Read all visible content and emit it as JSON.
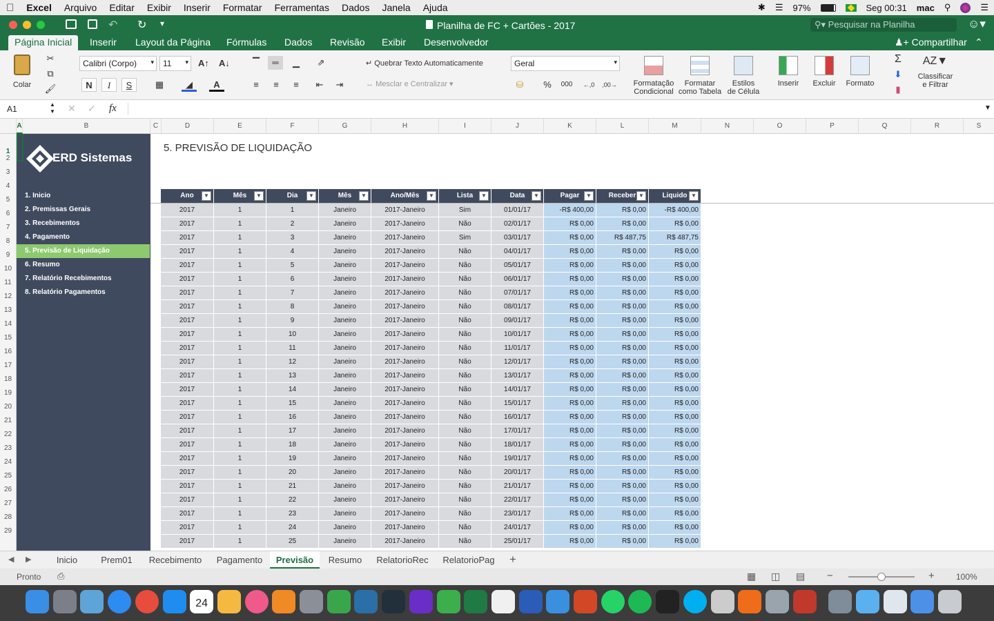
{
  "menubar": {
    "app": "Excel",
    "items": [
      "Arquivo",
      "Editar",
      "Exibir",
      "Inserir",
      "Formatar",
      "Ferramentas",
      "Dados",
      "Janela",
      "Ajuda"
    ],
    "battery": "97%",
    "time": "Seg 00:31",
    "user": "mac"
  },
  "window": {
    "title": "Planilha de FC + Cartões - 2017",
    "search_placeholder": "Pesquisar na Planilha"
  },
  "ribbon": {
    "tabs": [
      "Página Inicial",
      "Inserir",
      "Layout da Página",
      "Fórmulas",
      "Dados",
      "Revisão",
      "Exibir",
      "Desenvolvedor"
    ],
    "share": "Compartilhar",
    "paste": "Colar",
    "font": "Calibri (Corpo)",
    "font_size": "11",
    "wrap": "Quebrar Texto Automaticamente",
    "merge": "Mesclar e Centralizar",
    "number_format": "Geral",
    "percent": "%",
    "thousands": "000",
    "cond_format": [
      "Formatação",
      "Condicional"
    ],
    "format_table": [
      "Formatar",
      "como Tabela"
    ],
    "cell_styles": [
      "Estilos",
      "de Célula"
    ],
    "insert": "Inserir",
    "delete": "Excluir",
    "format": "Formato",
    "sort_filter": [
      "Classificar",
      "e Filtrar"
    ],
    "bold": "N",
    "italic": "I",
    "underline": "S"
  },
  "formula": {
    "name_box": "A1",
    "fx": "fx",
    "value": ""
  },
  "columns": [
    "A",
    "B",
    "C",
    "D",
    "E",
    "F",
    "G",
    "H",
    "I",
    "J",
    "K",
    "L",
    "M",
    "N",
    "O",
    "P",
    "Q",
    "R",
    "S"
  ],
  "rows": [
    "1",
    "2",
    "3",
    "4",
    "5",
    "6",
    "7",
    "8",
    "9",
    "10",
    "11",
    "12",
    "13",
    "14",
    "15",
    "16",
    "17",
    "18",
    "19",
    "20",
    "21",
    "22",
    "23",
    "24",
    "25",
    "26",
    "27",
    "28",
    "29"
  ],
  "sidebar": {
    "logo": "ERD Sistemas",
    "items": [
      "1. Inicio",
      "2. Premissas Gerais",
      "3. Recebimentos",
      "4. Pagamento",
      "5. Previsão de Liquidação",
      "6. Resumo",
      "7. Relatório Recebimentos",
      "8. Relatório Pagamentos"
    ],
    "active_index": 4
  },
  "sheet": {
    "title": "5. PREVISÃO DE LIQUIDAÇÃO",
    "headers": [
      "Ano",
      "Mês",
      "Dia",
      "Mês",
      "Ano/Mês",
      "Lista",
      "Data",
      "Pagar",
      "Receber",
      "Liquido"
    ],
    "rows": [
      [
        "2017",
        "1",
        "1",
        "Janeiro",
        "2017-Janeiro",
        "Sim",
        "01/01/17",
        "-R$ 400,00",
        "R$ 0,00",
        "-R$ 400,00"
      ],
      [
        "2017",
        "1",
        "2",
        "Janeiro",
        "2017-Janeiro",
        "Não",
        "02/01/17",
        "R$ 0,00",
        "R$ 0,00",
        "R$ 0,00"
      ],
      [
        "2017",
        "1",
        "3",
        "Janeiro",
        "2017-Janeiro",
        "Sim",
        "03/01/17",
        "R$ 0,00",
        "R$ 487,75",
        "R$ 487,75"
      ],
      [
        "2017",
        "1",
        "4",
        "Janeiro",
        "2017-Janeiro",
        "Não",
        "04/01/17",
        "R$ 0,00",
        "R$ 0,00",
        "R$ 0,00"
      ],
      [
        "2017",
        "1",
        "5",
        "Janeiro",
        "2017-Janeiro",
        "Não",
        "05/01/17",
        "R$ 0,00",
        "R$ 0,00",
        "R$ 0,00"
      ],
      [
        "2017",
        "1",
        "6",
        "Janeiro",
        "2017-Janeiro",
        "Não",
        "06/01/17",
        "R$ 0,00",
        "R$ 0,00",
        "R$ 0,00"
      ],
      [
        "2017",
        "1",
        "7",
        "Janeiro",
        "2017-Janeiro",
        "Não",
        "07/01/17",
        "R$ 0,00",
        "R$ 0,00",
        "R$ 0,00"
      ],
      [
        "2017",
        "1",
        "8",
        "Janeiro",
        "2017-Janeiro",
        "Não",
        "08/01/17",
        "R$ 0,00",
        "R$ 0,00",
        "R$ 0,00"
      ],
      [
        "2017",
        "1",
        "9",
        "Janeiro",
        "2017-Janeiro",
        "Não",
        "09/01/17",
        "R$ 0,00",
        "R$ 0,00",
        "R$ 0,00"
      ],
      [
        "2017",
        "1",
        "10",
        "Janeiro",
        "2017-Janeiro",
        "Não",
        "10/01/17",
        "R$ 0,00",
        "R$ 0,00",
        "R$ 0,00"
      ],
      [
        "2017",
        "1",
        "11",
        "Janeiro",
        "2017-Janeiro",
        "Não",
        "11/01/17",
        "R$ 0,00",
        "R$ 0,00",
        "R$ 0,00"
      ],
      [
        "2017",
        "1",
        "12",
        "Janeiro",
        "2017-Janeiro",
        "Não",
        "12/01/17",
        "R$ 0,00",
        "R$ 0,00",
        "R$ 0,00"
      ],
      [
        "2017",
        "1",
        "13",
        "Janeiro",
        "2017-Janeiro",
        "Não",
        "13/01/17",
        "R$ 0,00",
        "R$ 0,00",
        "R$ 0,00"
      ],
      [
        "2017",
        "1",
        "14",
        "Janeiro",
        "2017-Janeiro",
        "Não",
        "14/01/17",
        "R$ 0,00",
        "R$ 0,00",
        "R$ 0,00"
      ],
      [
        "2017",
        "1",
        "15",
        "Janeiro",
        "2017-Janeiro",
        "Não",
        "15/01/17",
        "R$ 0,00",
        "R$ 0,00",
        "R$ 0,00"
      ],
      [
        "2017",
        "1",
        "16",
        "Janeiro",
        "2017-Janeiro",
        "Não",
        "16/01/17",
        "R$ 0,00",
        "R$ 0,00",
        "R$ 0,00"
      ],
      [
        "2017",
        "1",
        "17",
        "Janeiro",
        "2017-Janeiro",
        "Não",
        "17/01/17",
        "R$ 0,00",
        "R$ 0,00",
        "R$ 0,00"
      ],
      [
        "2017",
        "1",
        "18",
        "Janeiro",
        "2017-Janeiro",
        "Não",
        "18/01/17",
        "R$ 0,00",
        "R$ 0,00",
        "R$ 0,00"
      ],
      [
        "2017",
        "1",
        "19",
        "Janeiro",
        "2017-Janeiro",
        "Não",
        "19/01/17",
        "R$ 0,00",
        "R$ 0,00",
        "R$ 0,00"
      ],
      [
        "2017",
        "1",
        "20",
        "Janeiro",
        "2017-Janeiro",
        "Não",
        "20/01/17",
        "R$ 0,00",
        "R$ 0,00",
        "R$ 0,00"
      ],
      [
        "2017",
        "1",
        "21",
        "Janeiro",
        "2017-Janeiro",
        "Não",
        "21/01/17",
        "R$ 0,00",
        "R$ 0,00",
        "R$ 0,00"
      ],
      [
        "2017",
        "1",
        "22",
        "Janeiro",
        "2017-Janeiro",
        "Não",
        "22/01/17",
        "R$ 0,00",
        "R$ 0,00",
        "R$ 0,00"
      ],
      [
        "2017",
        "1",
        "23",
        "Janeiro",
        "2017-Janeiro",
        "Não",
        "23/01/17",
        "R$ 0,00",
        "R$ 0,00",
        "R$ 0,00"
      ],
      [
        "2017",
        "1",
        "24",
        "Janeiro",
        "2017-Janeiro",
        "Não",
        "24/01/17",
        "R$ 0,00",
        "R$ 0,00",
        "R$ 0,00"
      ],
      [
        "2017",
        "1",
        "25",
        "Janeiro",
        "2017-Janeiro",
        "Não",
        "25/01/17",
        "R$ 0,00",
        "R$ 0,00",
        "R$ 0,00"
      ]
    ]
  },
  "sheet_tabs": [
    "Inicio",
    "Prem01",
    "Recebimento",
    "Pagamento",
    "Previsão",
    "Resumo",
    "RelatorioRec",
    "RelatorioPag"
  ],
  "active_sheet_index": 4,
  "status": {
    "text": "Pronto",
    "zoom": "100%"
  },
  "colors": {
    "excel_green": "#207245",
    "sidebar": "#404a5f",
    "active_nav": "#8dc96f",
    "money_cells": "#bdd7ee",
    "grey_cells": "#d9dadd"
  },
  "dock_icons": [
    "finder-icon",
    "launchpad-icon",
    "preview-icon",
    "safari-icon",
    "chrome-icon",
    "app-store-icon",
    "calendar-icon",
    "photos-icon",
    "itunes-icon",
    "books-icon",
    "system-prefs-icon",
    "evernote-icon",
    "mysql-icon",
    "quicktime-icon",
    "imovie-icon",
    "numbers-icon",
    "excel-icon",
    "textedit-icon",
    "word-icon",
    "keynote-icon",
    "powerpoint-icon",
    "whatsapp-icon",
    "spotify-icon",
    "activity-monitor-icon",
    "skype-icon",
    "disk-utility-icon",
    "sublime-icon",
    "script-editor-icon",
    "filezilla-icon",
    "printer-icon",
    "folder-icon",
    "mail-icon",
    "downloads-icon",
    "trash-icon"
  ],
  "calendar_day": "24"
}
